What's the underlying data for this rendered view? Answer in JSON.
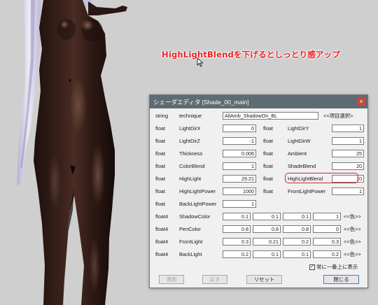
{
  "annotation": "HighLightBlendを下げるとしっとり感アップ",
  "dialog": {
    "title": "シェーダエディタ [Shade_00_main]",
    "close_glyph": "×",
    "technique_row": {
      "type": "string",
      "name": "technique",
      "value": "AllAmb_ShadowOn_BL",
      "select_label": "<<項目選択>"
    },
    "float_rows": [
      {
        "left": {
          "type": "float",
          "name": "LightDirX",
          "value": "0"
        },
        "right": {
          "type": "float",
          "name": "LightDirY",
          "value": "1"
        }
      },
      {
        "left": {
          "type": "float",
          "name": "LightDirZ",
          "value": "-1"
        },
        "right": {
          "type": "float",
          "name": "LightDirW",
          "value": "1"
        }
      },
      {
        "left": {
          "type": "float",
          "name": "Thickness",
          "value": "0.006"
        },
        "right": {
          "type": "float",
          "name": "Ambient",
          "value": "25"
        }
      },
      {
        "left": {
          "type": "float",
          "name": "ColorBlend",
          "value": "1"
        },
        "right": {
          "type": "float",
          "name": "ShadeBlend",
          "value": "20"
        }
      },
      {
        "left": {
          "type": "float",
          "name": "HighLight",
          "value": "29.21"
        },
        "right": {
          "type": "float",
          "name": "HighLightBlend",
          "value": "10"
        }
      },
      {
        "left": {
          "type": "float",
          "name": "HighLightPower",
          "value": "1000"
        },
        "right": {
          "type": "float",
          "name": "FrontLightPower",
          "value": "1"
        }
      },
      {
        "left": {
          "type": "float",
          "name": "BackLightPower",
          "value": "1"
        }
      }
    ],
    "color_rows": [
      {
        "type": "float4",
        "name": "ShadowColor",
        "values": [
          "0.1",
          "0.1",
          "0.1",
          "1"
        ],
        "picker": "<<色>>"
      },
      {
        "type": "float4",
        "name": "PenColor",
        "values": [
          "0.8",
          "0.8",
          "0.8",
          "0"
        ],
        "picker": "<<色>>"
      },
      {
        "type": "float4",
        "name": "FrontLight",
        "values": [
          "0.3",
          "0.21",
          "0.2",
          "0.3"
        ],
        "picker": "<<色>>"
      },
      {
        "type": "float4",
        "name": "BackLight",
        "values": [
          "0.2",
          "0.1",
          "0.1",
          "0.2"
        ],
        "picker": "<<色>>"
      }
    ],
    "always_on_top": {
      "label": "常に一番上に表示",
      "checked": true,
      "mark": "✓"
    },
    "buttons": {
      "apply": "適用",
      "revert": "戻す",
      "reset": "リセット",
      "close": "閉じる"
    }
  },
  "colors": {
    "background": "#cfcfcf",
    "skin_dark": "#2a1612",
    "skin_highlight": "#a07660",
    "hair": "#dcd8ee",
    "titlebar": "#5f6b72",
    "annotation_red": "#ee2222",
    "highlight_box": "#e02020"
  }
}
